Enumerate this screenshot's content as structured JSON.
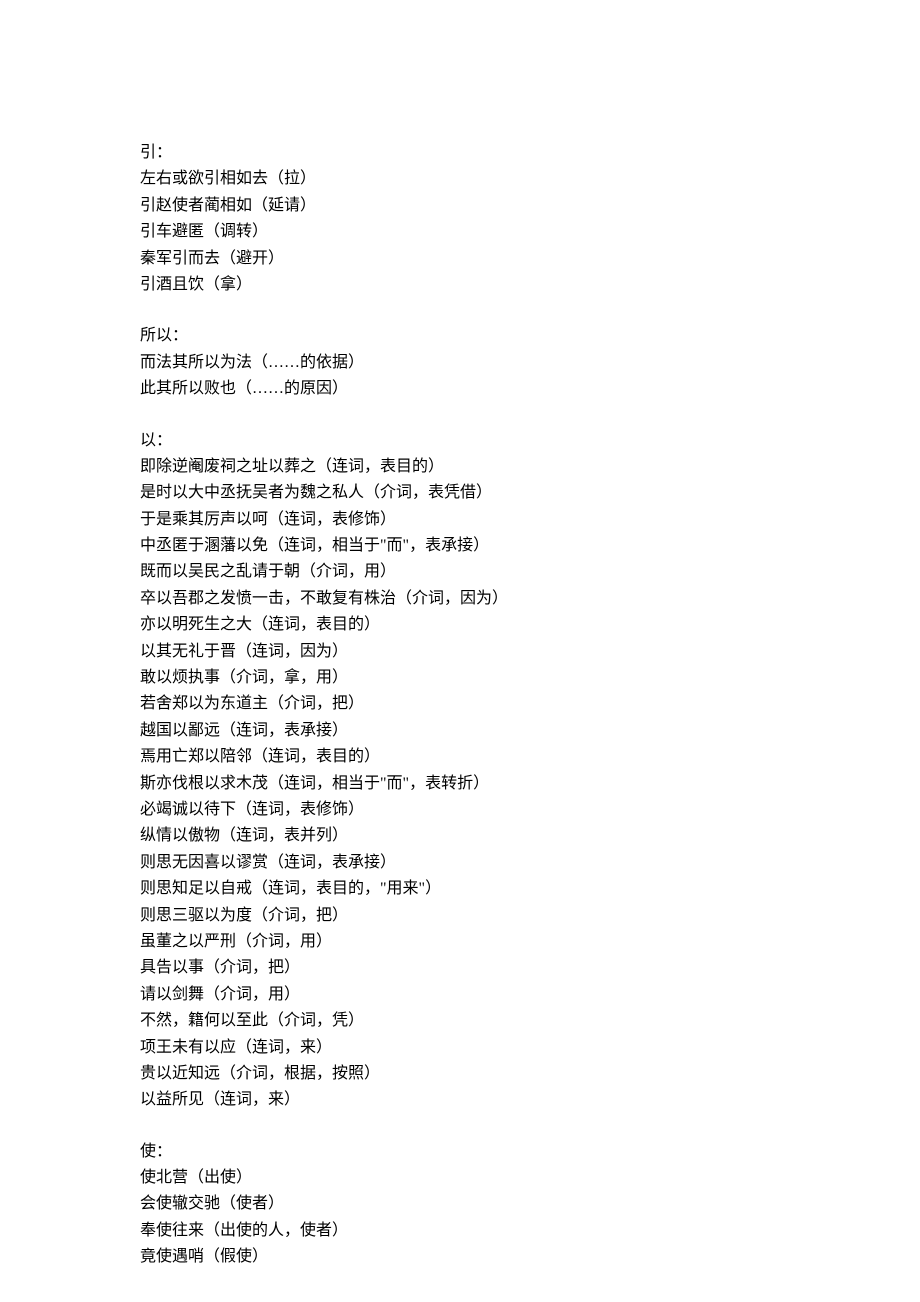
{
  "sections": [
    {
      "heading": "引：",
      "lines": [
        "左右或欲引相如去（拉）",
        "引赵使者蔺相如（延请）",
        "引车避匿（调转）",
        "秦军引而去（避开）",
        "引酒且饮（拿）"
      ]
    },
    {
      "heading": "所以：",
      "lines": [
        "而法其所以为法（……的依据）",
        "此其所以败也（……的原因）"
      ]
    },
    {
      "heading": "以：",
      "lines": [
        "即除逆阉废祠之址以葬之（连词，表目的）",
        "是时以大中丞抚吴者为魏之私人（介词，表凭借）",
        "于是乘其厉声以呵（连词，表修饰）",
        "中丞匿于溷藩以免（连词，相当于\"而\"，表承接）",
        "既而以吴民之乱请于朝（介词，用）",
        "卒以吾郡之发愤一击，不敢复有株治（介词，因为）",
        "亦以明死生之大（连词，表目的）",
        "以其无礼于晋（连词，因为）",
        "敢以烦执事（介词，拿，用）",
        "若舍郑以为东道主（介词，把）",
        "越国以鄙远（连词，表承接）",
        "焉用亡郑以陪邻（连词，表目的）",
        "斯亦伐根以求木茂（连词，相当于\"而\"，表转折）",
        "必竭诚以待下（连词，表修饰）",
        "纵情以傲物（连词，表并列）",
        "则思无因喜以谬赏（连词，表承接）",
        "则思知足以自戒（连词，表目的，\"用来\"）",
        "则思三驱以为度（介词，把）",
        "虽董之以严刑（介词，用）",
        "具告以事（介词，把）",
        "请以剑舞（介词，用）",
        "不然，籍何以至此（介词，凭）",
        "项王未有以应（连词，来）",
        "贵以近知远（介词，根据，按照）",
        "以益所见（连词，来）"
      ]
    },
    {
      "heading": "使：",
      "lines": [
        "使北营（出使）",
        "会使辙交驰（使者）",
        "奉使往来（出使的人，使者）",
        "竟使遇哨（假使）"
      ]
    }
  ]
}
